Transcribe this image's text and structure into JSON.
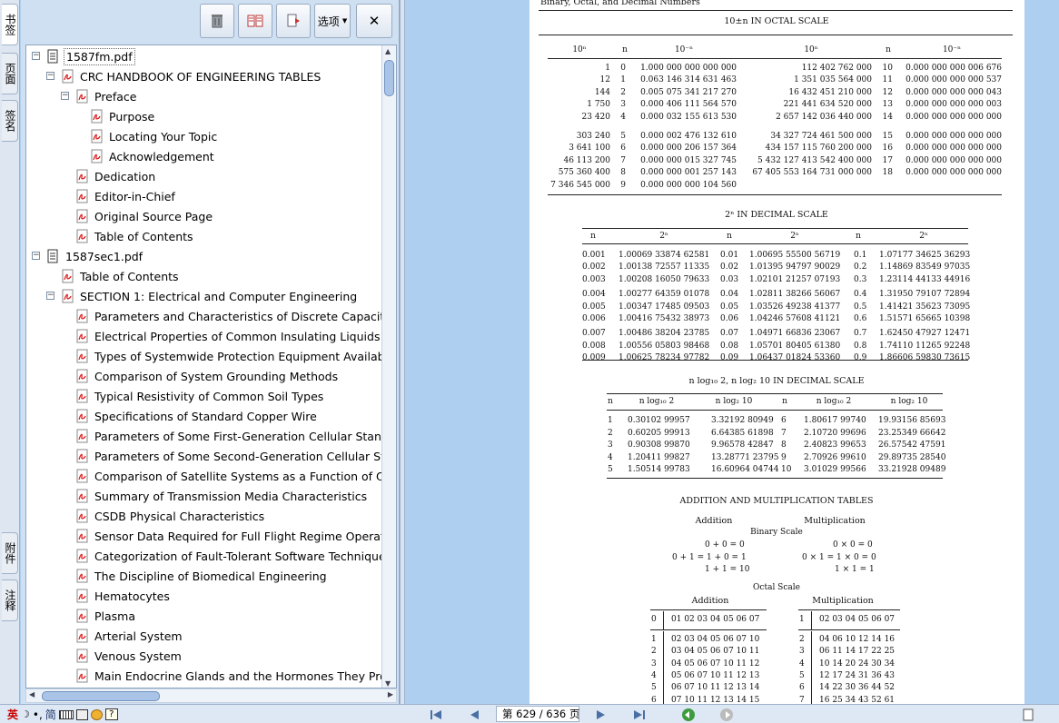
{
  "side_tabs": [
    "书签",
    "页面",
    "签名",
    "附件",
    "注释"
  ],
  "toolbar": {
    "options_label": "选项"
  },
  "tree": [
    {
      "level": 0,
      "toggle": "-",
      "icon": "doc",
      "label": "1587fm.pdf",
      "selected": true
    },
    {
      "level": 1,
      "toggle": "-",
      "icon": "pdf",
      "label": "CRC HANDBOOK OF ENGINEERING TABLES"
    },
    {
      "level": 2,
      "toggle": "-",
      "icon": "pdf",
      "label": "Preface"
    },
    {
      "level": 3,
      "toggle": "",
      "icon": "pdf",
      "label": "Purpose"
    },
    {
      "level": 3,
      "toggle": "",
      "icon": "pdf",
      "label": "Locating Your Topic"
    },
    {
      "level": 3,
      "toggle": "",
      "icon": "pdf",
      "label": "Acknowledgement"
    },
    {
      "level": 2,
      "toggle": "",
      "icon": "pdf",
      "label": "Dedication"
    },
    {
      "level": 2,
      "toggle": "",
      "icon": "pdf",
      "label": "Editor-in-Chief"
    },
    {
      "level": 2,
      "toggle": "",
      "icon": "pdf",
      "label": "Original Source Page"
    },
    {
      "level": 2,
      "toggle": "",
      "icon": "pdf",
      "label": "Table of Contents"
    },
    {
      "level": 0,
      "toggle": "-",
      "icon": "doc",
      "label": "1587sec1.pdf"
    },
    {
      "level": 1,
      "toggle": "",
      "icon": "pdf",
      "label": "Table of Contents"
    },
    {
      "level": 1,
      "toggle": "-",
      "icon": "pdf",
      "label": "SECTION 1: Electrical and Computer Engineering"
    },
    {
      "level": 2,
      "toggle": "",
      "icon": "pdf",
      "label": "Parameters and Characteristics of Discrete Capacitors"
    },
    {
      "level": 2,
      "toggle": "",
      "icon": "pdf",
      "label": "Electrical Properties of Common Insulating Liquids"
    },
    {
      "level": 2,
      "toggle": "",
      "icon": "pdf",
      "label": "Types of Systemwide Protection Equipment Available to"
    },
    {
      "level": 2,
      "toggle": "",
      "icon": "pdf",
      "label": "Comparison of System Grounding Methods"
    },
    {
      "level": 2,
      "toggle": "",
      "icon": "pdf",
      "label": "Typical Resistivity of Common Soil Types"
    },
    {
      "level": 2,
      "toggle": "",
      "icon": "pdf",
      "label": "Specifications of Standard Copper Wire"
    },
    {
      "level": 2,
      "toggle": "",
      "icon": "pdf",
      "label": "Parameters of Some First-Generation Cellular Standards"
    },
    {
      "level": 2,
      "toggle": "",
      "icon": "pdf",
      "label": "Parameters of Some Second-Generation Cellular Standa"
    },
    {
      "level": 2,
      "toggle": "",
      "icon": "pdf",
      "label": "Comparison of Satellite Systems as a Function of Orbit"
    },
    {
      "level": 2,
      "toggle": "",
      "icon": "pdf",
      "label": "Summary of Transmission Media Characteristics"
    },
    {
      "level": 2,
      "toggle": "",
      "icon": "pdf",
      "label": "CSDB Physical Characteristics"
    },
    {
      "level": 2,
      "toggle": "",
      "icon": "pdf",
      "label": "Sensor Data Required for Full Flight Regime Operation"
    },
    {
      "level": 2,
      "toggle": "",
      "icon": "pdf",
      "label": "Categorization of Fault-Tolerant Software Techniques"
    },
    {
      "level": 2,
      "toggle": "",
      "icon": "pdf",
      "label": "The Discipline of Biomedical Engineering"
    },
    {
      "level": 2,
      "toggle": "",
      "icon": "pdf",
      "label": "Hematocytes"
    },
    {
      "level": 2,
      "toggle": "",
      "icon": "pdf",
      "label": "Plasma"
    },
    {
      "level": 2,
      "toggle": "",
      "icon": "pdf",
      "label": "Arterial System"
    },
    {
      "level": 2,
      "toggle": "",
      "icon": "pdf",
      "label": "Venous System"
    },
    {
      "level": 2,
      "toggle": "",
      "icon": "pdf",
      "label": "Main Endocrine Glands and the Hormones They Produce"
    }
  ],
  "status": {
    "page_indicator": "第 629 / 636 页",
    "ime_labels": [
      "英",
      "简"
    ]
  },
  "document": {
    "running_head": "Binary, Octal, and Decimal Numbers",
    "octal_table": {
      "title": "10±n IN OCTAL SCALE",
      "headers": [
        "10ⁿ",
        "n",
        "10⁻ⁿ",
        "10ⁿ",
        "n",
        "10⁻ⁿ"
      ],
      "rows": [
        [
          "1",
          "0",
          "1.000 000 000 000 000",
          "112 402 762 000",
          "10",
          "0.000 000 000 006 676"
        ],
        [
          "12",
          "1",
          "0.063 146 314 631 463",
          "1 351 035 564 000",
          "11",
          "0.000 000 000 000 537"
        ],
        [
          "144",
          "2",
          "0.005 075 341 217 270",
          "16 432 451 210 000",
          "12",
          "0.000 000 000 000 043"
        ],
        [
          "1 750",
          "3",
          "0.000 406 111 564 570",
          "221 441 634 520 000",
          "13",
          "0.000 000 000 000 003"
        ],
        [
          "23 420",
          "4",
          "0.000 032 155 613 530",
          "2 657 142 036 440 000",
          "14",
          "0.000 000 000 000 000"
        ],
        [
          "303 240",
          "5",
          "0.000 002 476 132 610",
          "34 327 724 461 500 000",
          "15",
          "0.000 000 000 000 000"
        ],
        [
          "3 641 100",
          "6",
          "0.000 000 206 157 364",
          "434 157 115 760 200 000",
          "16",
          "0.000 000 000 000 000"
        ],
        [
          "46 113 200",
          "7",
          "0.000 000 015 327 745",
          "5 432 127 413 542 400 000",
          "17",
          "0.000 000 000 000 000"
        ],
        [
          "575 360 400",
          "8",
          "0.000 000 001 257 143",
          "67 405 553 164 731 000 000",
          "18",
          "0.000 000 000 000 000"
        ],
        [
          "7 346 545 000",
          "9",
          "0.000 000 000 104 560",
          "",
          "",
          ""
        ]
      ]
    },
    "decimal_table": {
      "title": "2ⁿ IN DECIMAL SCALE",
      "headers": [
        "n",
        "2ⁿ",
        "n",
        "2ⁿ",
        "n",
        "2ⁿ"
      ],
      "rows": [
        [
          "0.001",
          "1.00069 33874 62581",
          "0.01",
          "1.00695 55500 56719",
          "0.1",
          "1.07177 34625 36293"
        ],
        [
          "0.002",
          "1.00138 72557 11335",
          "0.02",
          "1.01395 94797 90029",
          "0.2",
          "1.14869 83549 97035"
        ],
        [
          "0.003",
          "1.00208 16050 79633",
          "0.03",
          "1.02101 21257 07193",
          "0.3",
          "1.23114 44133 44916"
        ],
        [
          "0.004",
          "1.00277 64359 01078",
          "0.04",
          "1.02811 38266 56067",
          "0.4",
          "1.31950 79107 72894"
        ],
        [
          "0.005",
          "1.00347 17485 09503",
          "0.05",
          "1.03526 49238 41377",
          "0.5",
          "1.41421 35623 73095"
        ],
        [
          "0.006",
          "1.00416 75432 38973",
          "0.06",
          "1.04246 57608 41121",
          "0.6",
          "1.51571 65665 10398"
        ],
        [
          "0.007",
          "1.00486 38204 23785",
          "0.07",
          "1.04971 66836 23067",
          "0.7",
          "1.62450 47927 12471"
        ],
        [
          "0.008",
          "1.00556 05803 98468",
          "0.08",
          "1.05701 80405 61380",
          "0.8",
          "1.74110 11265 92248"
        ],
        [
          "0.009",
          "1.00625 78234 97782",
          "0.09",
          "1.06437 01824 53360",
          "0.9",
          "1.86606 59830 73615"
        ]
      ]
    },
    "log_table": {
      "title": "n log₁₀ 2, n log₂ 10 IN DECIMAL SCALE",
      "headers": [
        "n",
        "n log₁₀ 2",
        "n log₂ 10",
        "n",
        "n log₁₀ 2",
        "n log₂ 10"
      ],
      "rows": [
        [
          "1",
          "0.30102 99957",
          "3.32192 80949",
          "6",
          "1.80617 99740",
          "19.93156 85693"
        ],
        [
          "2",
          "0.60205 99913",
          "6.64385 61898",
          "7",
          "2.10720 99696",
          "23.25349 66642"
        ],
        [
          "3",
          "0.90308 99870",
          "9.96578 42847",
          "8",
          "2.40823 99653",
          "26.57542 47591"
        ],
        [
          "4",
          "1.20411 99827",
          "13.28771 23795",
          "9",
          "2.70926 99610",
          "29.89735 28540"
        ],
        [
          "5",
          "1.50514 99783",
          "16.60964 04744",
          "10",
          "3.01029 99566",
          "33.21928 09489"
        ]
      ]
    },
    "arith": {
      "title": "ADDITION AND MULTIPLICATION TABLES",
      "addition_label": "Addition",
      "multiplication_label": "Multiplication",
      "binary_label": "Binary Scale",
      "binary_add": [
        "0 + 0 =  0",
        "0 + 1 = 1 + 0 =  1",
        "1 + 1 = 10"
      ],
      "binary_mul": [
        "0 × 0 = 0",
        "0 × 1 = 1 × 0 = 0",
        "1 × 1 = 1"
      ],
      "octal_label": "Octal Scale",
      "octal_add_header": [
        "0",
        "01 02 03 04 05 06 07"
      ],
      "octal_add_rows": [
        [
          "1",
          "02 03 04 05 06 07 10"
        ],
        [
          "2",
          "03 04 05 06 07 10 11"
        ],
        [
          "3",
          "04 05 06 07 10 11 12"
        ],
        [
          "4",
          "05 06 07 10 11 12 13"
        ],
        [
          "5",
          "06 07 10 11 12 13 14"
        ],
        [
          "6",
          "07 10 11 12 13 14 15"
        ]
      ],
      "octal_mul_header": [
        "1",
        "02 03 04 05 06 07"
      ],
      "octal_mul_rows": [
        [
          "2",
          "04 06 10 12 14 16"
        ],
        [
          "3",
          "06 11 14 17 22 25"
        ],
        [
          "4",
          "10 14 20 24 30 34"
        ],
        [
          "5",
          "12 17 24 31 36 43"
        ],
        [
          "6",
          "14 22 30 36 44 52"
        ],
        [
          "7",
          "16 25 34 43 52 61"
        ]
      ]
    }
  }
}
